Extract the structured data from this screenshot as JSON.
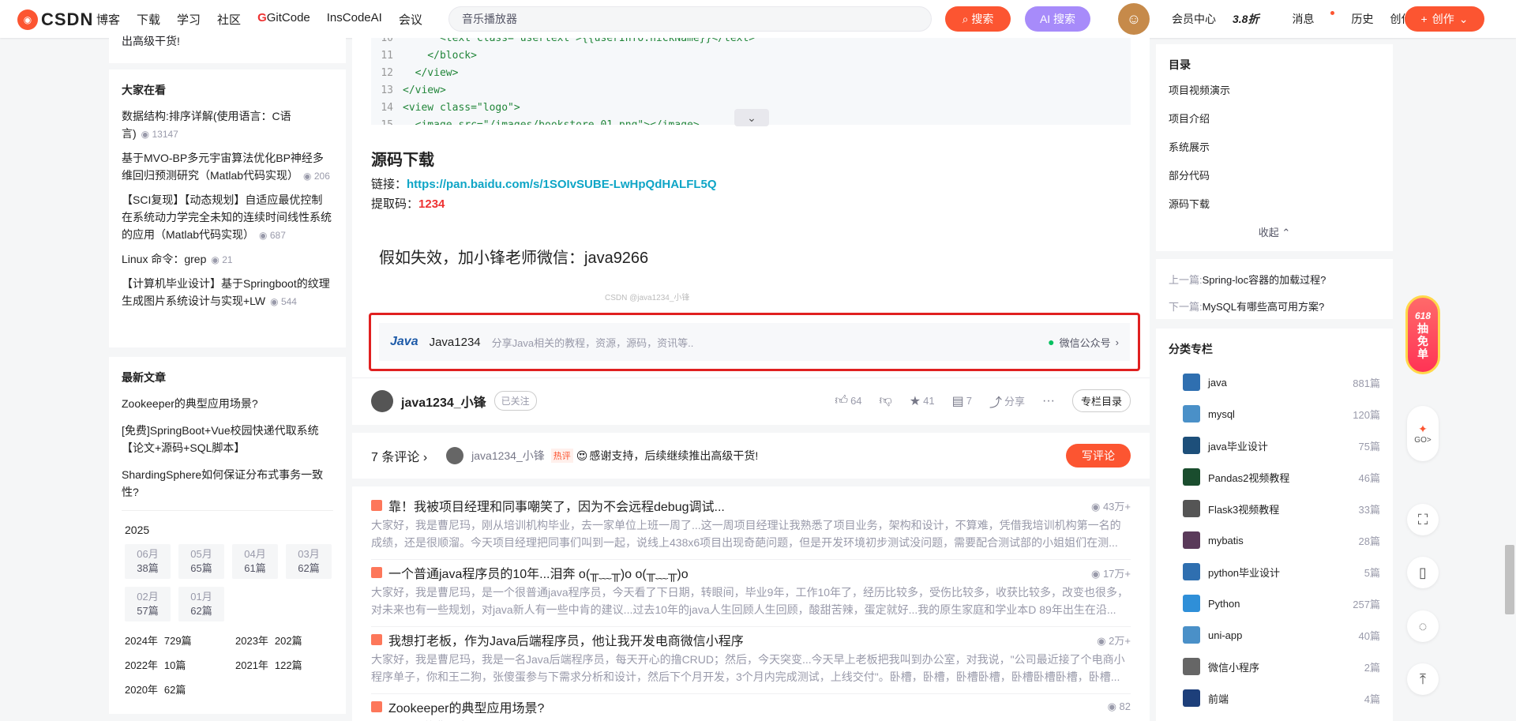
{
  "nav": {
    "logo_text": "CSDN",
    "items": [
      "博客",
      "下载",
      "学习",
      "社区",
      "GitCode",
      "InsCodeAI",
      "会议"
    ],
    "search_value": "音乐播放器",
    "search_button": "搜索",
    "ai_search_button": "AI 搜索",
    "right_items": {
      "vip": "会员中心",
      "vip_badge": "3.8折",
      "messages": "消息",
      "history": "历史",
      "creator": "创作中心"
    },
    "create_button": "创作"
  },
  "left": {
    "top_text": "出高级干货!",
    "hot_title": "大家在看",
    "hot_items": [
      {
        "title": "数据结构:排序详解(使用语言：C语言)",
        "views": "13147"
      },
      {
        "title": "基于MVO-BP多元宇宙算法优化BP神经多维回归预测研究（Matlab代码实现）",
        "views": "206"
      },
      {
        "title": "【SCI复现】【动态规划】自适应最优控制在系统动力学完全未知的连续时间线性系统的应用（Matlab代码实现）",
        "views": "687"
      },
      {
        "title": "Linux 命令：grep",
        "views": "21"
      },
      {
        "title": "【计算机毕业设计】基于Springboot的纹理生成图片系统设计与实现+LW",
        "views": "544"
      }
    ],
    "new_title": "最新文章",
    "new_items": [
      "Zookeeper的典型应用场景?",
      "[免费]SpringBoot+Vue校园快递代取系统【论文+源码+SQL脚本】",
      "ShardingSphere如何保证分布式事务一致性?"
    ],
    "year": "2025",
    "months": [
      {
        "m": "06月",
        "c": "38篇"
      },
      {
        "m": "05月",
        "c": "65篇"
      },
      {
        "m": "04月",
        "c": "61篇"
      },
      {
        "m": "03月",
        "c": "62篇"
      },
      {
        "m": "02月",
        "c": "57篇"
      },
      {
        "m": "01月",
        "c": "62篇"
      }
    ],
    "years": [
      {
        "y": "2024年",
        "c": "729篇"
      },
      {
        "y": "2023年",
        "c": "202篇"
      },
      {
        "y": "2022年",
        "c": "10篇"
      },
      {
        "y": "2021年",
        "c": "122篇"
      },
      {
        "y": "2020年",
        "c": "62篇"
      }
    ]
  },
  "article": {
    "code_lines": [
      {
        "n": "10",
        "t": "      <text class=\"usertext\">{{userInfo.nickName}}</text>"
      },
      {
        "n": "11",
        "t": "    </block>"
      },
      {
        "n": "12",
        "t": "  </view>"
      },
      {
        "n": "13",
        "t": "</view>"
      },
      {
        "n": "14",
        "t": "<view class=\"logo\">"
      },
      {
        "n": "15",
        "t": "  <image src=\"/images/bookstore_01.png\"></image>"
      }
    ],
    "heading": "源码下载",
    "link_label": "链接：",
    "link_url": "https://pan.baidu.com/s/1SOIvSUBE-LwHpQdHALFL5Q",
    "code_label": "提取码：",
    "code_value": "1234",
    "notice": "假如失效，加小锋老师微信：java9266",
    "watermark": "CSDN @java1234_小锋",
    "wechat": {
      "logo": "Java",
      "name": "Java1234",
      "desc": "分享Java相关的教程，资源，源码，资讯等..",
      "right": "微信公众号"
    },
    "author": {
      "name": "java1234_小锋",
      "follow": "已关注"
    },
    "actions": {
      "like": "64",
      "star": "41",
      "comment": "7",
      "share": "分享",
      "catalog": "专栏目录"
    }
  },
  "comments": {
    "count": "7 条评论",
    "top_user": "java1234_小锋",
    "hot": "热评",
    "text": "感谢支持，后续继续推出高级干货!",
    "write": "写评论"
  },
  "recommend": [
    {
      "title": "靠！我被项目经理和同事嘲笑了，因为不会远程debug调试...",
      "views": "43万+",
      "desc": "大家好，我是曹尼玛，刚从培训机构毕业，去一家单位上班一周了...这一周项目经理让我熟悉了项目业务，架构和设计，不算难，凭借我培训机构第一名的成绩，还是很顺溜。今天项目经理把同事们叫到一起，说线上438x6项目出现奇葩问题，但是开发环境初步测试没问题，需要配合测试部的小姐姐们在测..."
    },
    {
      "title": "一个普通java程序员的10年...泪奔 o(╥﹏╥)o o(╥﹏╥)o",
      "views": "17万+",
      "desc": "大家好，我是曹尼玛，是一个很普通java程序员，今天看了下日期，转眼间，毕业9年，工作10年了，经历比较多，受伤比较多，收获比较多，改变也很多，对未来也有一些规划，对java新人有一些中肯的建议...过去10年的java人生回顾人生回顾，酸甜苦辣，蛋定就好...我的原生家庭和学业本D 89年出生在沿..."
    },
    {
      "title": "我想打老板，作为Java后端程序员，他让我开发电商微信小程序",
      "views": "2万+",
      "desc": "大家好，我是曹尼玛，我是一名Java后端程序员，每天开心的撸CRUD；然后，今天突变...今天早上老板把我叫到办公室，对我说，\"公司最近接了个电商小程序单子，你和王二狗，张傻蛋参与下需求分析和设计，然后下个月开发，3个月内完成测试，上线交付\"。卧槽，卧槽，卧槽卧槽，卧槽卧槽卧槽，卧槽..."
    },
    {
      "title": "Zookeeper的典型应用场景?",
      "views": "82",
      "desc": "Zookeeper的典型应用场景?"
    }
  ],
  "right": {
    "toc_title": "目录",
    "toc_items": [
      "项目视频演示",
      "项目介绍",
      "系统展示",
      "部分代码",
      "源码下载"
    ],
    "toc_collapse": "收起",
    "prev_label": "上一篇:",
    "prev_title": "Spring-loc容器的加载过程?",
    "next_label": "下一篇:",
    "next_title": "MySQL有哪些高可用方案?",
    "cat_title": "分类专栏",
    "categories": [
      {
        "name": "java",
        "count": "881篇",
        "color": "#2f6fb0"
      },
      {
        "name": "mysql",
        "count": "120篇",
        "color": "#4a90c8"
      },
      {
        "name": "java毕业设计",
        "count": "75篇",
        "color": "#1d4f7a"
      },
      {
        "name": "Pandas2视频教程",
        "count": "46篇",
        "color": "#1a4d2e"
      },
      {
        "name": "Flask3视频教程",
        "count": "33篇",
        "color": "#555"
      },
      {
        "name": "mybatis",
        "count": "28篇",
        "color": "#5a3a5a"
      },
      {
        "name": "python毕业设计",
        "count": "5篇",
        "color": "#2f6fb0"
      },
      {
        "name": "Python",
        "count": "257篇",
        "color": "#2f8fd8"
      },
      {
        "name": "uni-app",
        "count": "40篇",
        "color": "#4a90c8"
      },
      {
        "name": "微信小程序",
        "count": "2篇",
        "color": "#666"
      },
      {
        "name": "前端",
        "count": "4篇",
        "color": "#1d3f7a"
      }
    ]
  },
  "float": {
    "promo": [
      "618",
      "抽",
      "免",
      "单"
    ],
    "go": "GO>"
  }
}
